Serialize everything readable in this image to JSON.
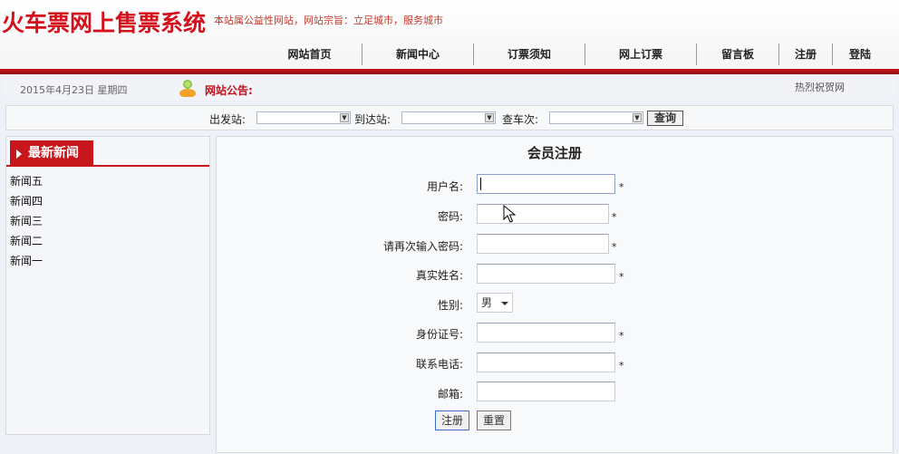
{
  "header": {
    "site_title": "火车票网上售票系统",
    "slogan": "本站属公益性网站，网站宗旨：立足城市，服务城市",
    "nav": [
      "网站首页",
      "新闻中心",
      "订票须知",
      "网上订票",
      "留言板",
      "注册",
      "登陆"
    ]
  },
  "topbar": {
    "date": "2015年4月23日 星期四",
    "notice_label": "网站公告:",
    "hotlink": "热烈祝贺网"
  },
  "search": {
    "from_label": "出发站:",
    "to_label": "到达站:",
    "train_label": "查车次:",
    "query_button": "查询"
  },
  "news": {
    "title": "最新新闻",
    "items": [
      "新闻五",
      "新闻四",
      "新闻三",
      "新闻二",
      "新闻一"
    ]
  },
  "form": {
    "title": "会员注册",
    "username_label": "用户名:",
    "password_label": "密码:",
    "confirm_label": "请再次输入密码:",
    "realname_label": "真实姓名:",
    "sex_label": "性别:",
    "sex_value": "男",
    "idcard_label": "身份证号:",
    "phone_label": "联系电话:",
    "email_label": "邮箱:",
    "required_mark": "*",
    "submit_button": "注册",
    "reset_button": "重置"
  },
  "colors": {
    "brand_red": "#c8161d",
    "title_red": "#d4101c"
  },
  "icons": {
    "notice": "people-icon",
    "cursor": "mouse-pointer-icon"
  }
}
